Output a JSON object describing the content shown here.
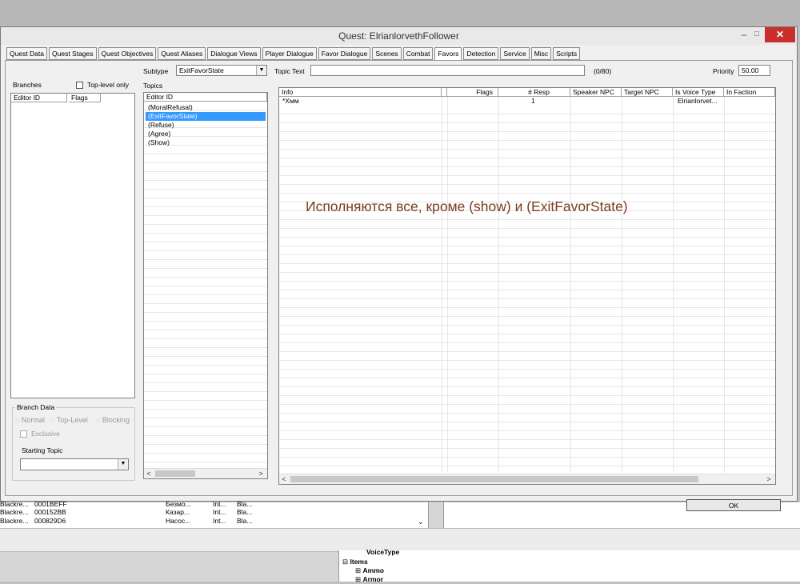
{
  "window": {
    "title": "Quest: ElrianlorvethFollower",
    "min_glyph": "–",
    "max_glyph": "□",
    "close_glyph": "✕"
  },
  "tabs": [
    "Quest Data",
    "Quest Stages",
    "Quest Objectives",
    "Quest Aliases",
    "Dialogue Views",
    "Player Dialogue",
    "Favor Dialogue",
    "Scenes",
    "Combat",
    "Favors",
    "Detection",
    "Service",
    "Misc",
    "Scripts"
  ],
  "active_tab": "Favors",
  "branches": {
    "label": "Branches",
    "top_level_only_label": "Top-level only",
    "columns": [
      "Editor ID",
      "Flags"
    ]
  },
  "branch_data": {
    "label": "Branch Data",
    "normal_label": "Normal",
    "top_level_label": "Top-Level",
    "blocking_label": "Blocking",
    "exclusive_label": "Exclusive",
    "starting_topic_label": "Starting Topic"
  },
  "subtype": {
    "label": "Subtype",
    "value": "ExitFavorState"
  },
  "topics": {
    "label": "Topics",
    "column": "Editor ID",
    "items": [
      "(MoralRefusal)",
      "(ExitFavorState)",
      "(Refuse)",
      "(Agree)",
      "(Show)"
    ],
    "selected_index": 1
  },
  "topic_text": {
    "label": "Topic Text",
    "value": "",
    "counter": "(0/80)"
  },
  "priority": {
    "label": "Priority",
    "value": "50.00"
  },
  "info_table": {
    "columns": [
      "Info",
      "Flags",
      "# Resp",
      "Speaker NPC",
      "Target NPC",
      "Is Voice Type",
      "In Faction"
    ],
    "rows": [
      {
        "info": "*Хмм",
        "flags": "",
        "resp": "1",
        "speaker": "",
        "target": "",
        "voice": "Elrianlorvet...",
        "faction": ""
      }
    ]
  },
  "annotation": "Исполняются все, кроме (show) и (ExitFavorState)",
  "ok_label": "OK",
  "background": {
    "rows": [
      {
        "a": "Blackre...",
        "b": "0001BEFF",
        "c": "Безмо...",
        "d": "Int...",
        "e": "Bla..."
      },
      {
        "a": "Blackre...",
        "b": "000152BB",
        "c": "Казар...",
        "d": "Int...",
        "e": "Bla..."
      },
      {
        "a": "Blackre...",
        "b": "000829D6",
        "c": "Насос...",
        "d": "Int...",
        "e": "Bla..."
      }
    ],
    "tree": {
      "voice_type": "VoiceType",
      "items": "Items",
      "ammo": "Ammo",
      "armor": "Armor"
    }
  }
}
